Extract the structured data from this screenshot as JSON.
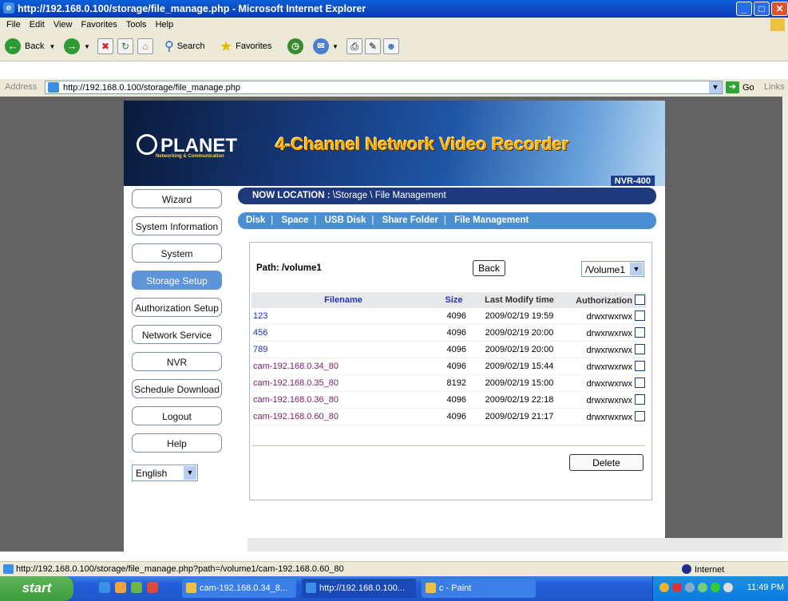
{
  "window": {
    "title": "http://192.168.0.100/storage/file_manage.php - Microsoft Internet Explorer"
  },
  "menu": [
    "File",
    "Edit",
    "View",
    "Favorites",
    "Tools",
    "Help"
  ],
  "toolbar": {
    "back": "Back",
    "search": "Search",
    "favorites": "Favorites"
  },
  "address": {
    "label": "Address",
    "url": "http://192.168.0.100/storage/file_manage.php",
    "go": "Go",
    "links": "Links"
  },
  "banner": {
    "logo": "PLANET",
    "logo_sub": "Networking & Communication",
    "title": "4-Channel Network Video Recorder",
    "model": "NVR-400"
  },
  "sidebar": {
    "items": [
      {
        "label": "Wizard",
        "active": false
      },
      {
        "label": "System Information",
        "active": false
      },
      {
        "label": "System",
        "active": false
      },
      {
        "label": "Storage Setup",
        "active": true
      },
      {
        "label": "Authorization Setup",
        "active": false
      },
      {
        "label": "Network Service",
        "active": false
      },
      {
        "label": "NVR",
        "active": false
      },
      {
        "label": "Schedule Download",
        "active": false
      },
      {
        "label": "Logout",
        "active": false
      },
      {
        "label": "Help",
        "active": false
      }
    ],
    "language": "English"
  },
  "location": {
    "label": "NOW LOCATION :",
    "path": "\\Storage \\ File Management"
  },
  "tabs": [
    "Disk",
    "Space",
    "USB Disk",
    "Share Folder",
    "File Management"
  ],
  "file_panel": {
    "path_label": "Path: /volume1",
    "back_button": "Back",
    "volume": "/Volume1",
    "columns": [
      "Filename",
      "Size",
      "Last Modify time",
      "Authorization"
    ],
    "rows": [
      {
        "name": "123",
        "size": "4096",
        "time": "2009/02/19 19:59",
        "auth": "drwxrwxrwx"
      },
      {
        "name": "456",
        "size": "4096",
        "time": "2009/02/19 20:00",
        "auth": "drwxrwxrwx"
      },
      {
        "name": "789",
        "size": "4096",
        "time": "2009/02/19 20:00",
        "auth": "drwxrwxrwx"
      },
      {
        "name": "cam-192.168.0.34_80",
        "size": "4096",
        "time": "2009/02/19 15:44",
        "auth": "drwxrwxrwx"
      },
      {
        "name": "cam-192.168.0.35_80",
        "size": "8192",
        "time": "2009/02/19 15:00",
        "auth": "drwxrwxrwx"
      },
      {
        "name": "cam-192.168.0.36_80",
        "size": "4096",
        "time": "2009/02/19 22:18",
        "auth": "drwxrwxrwx"
      },
      {
        "name": "cam-192.168.0.60_80",
        "size": "4096",
        "time": "2009/02/19 21:17",
        "auth": "drwxrwxrwx"
      }
    ],
    "delete_button": "Delete"
  },
  "status": {
    "url": "http://192.168.0.100/storage/file_manage.php?path=/volume1/cam-192.168.0.60_80",
    "zone": "Internet"
  },
  "taskbar": {
    "start": "start",
    "tasks": [
      "cam-192.168.0.34_8...",
      "http://192.168.0.100...",
      "c - Paint"
    ],
    "clock": "11:49 PM"
  }
}
